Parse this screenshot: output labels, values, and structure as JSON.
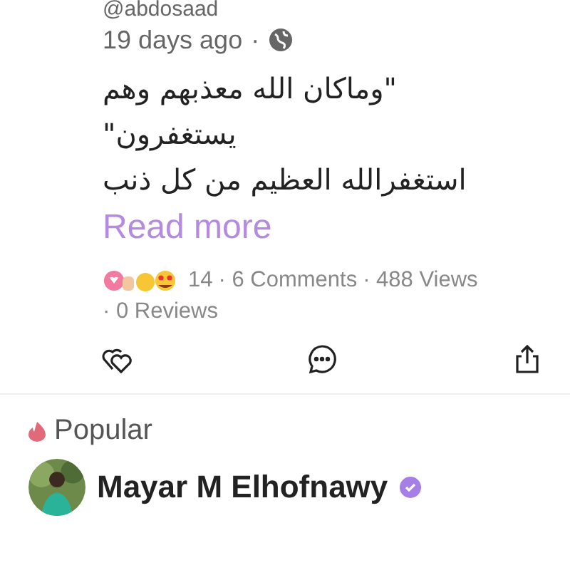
{
  "post": {
    "handle": "@abdosaad",
    "time": "19 days ago",
    "separator": "·",
    "lines": [
      "\"وماكان الله معذبهم وهم",
      "يستغفرون\"",
      "استغفرالله العظيم من كل ذنب"
    ],
    "read_more": "Read more",
    "reactions_count": "14",
    "stats": [
      {
        "text": "· 6 Comments"
      },
      {
        "text": "· 488 Views"
      },
      {
        "text": "· 0 Reviews"
      }
    ]
  },
  "popular": {
    "title": "Popular",
    "author": "Mayar M Elhofnawy",
    "verified": true
  }
}
